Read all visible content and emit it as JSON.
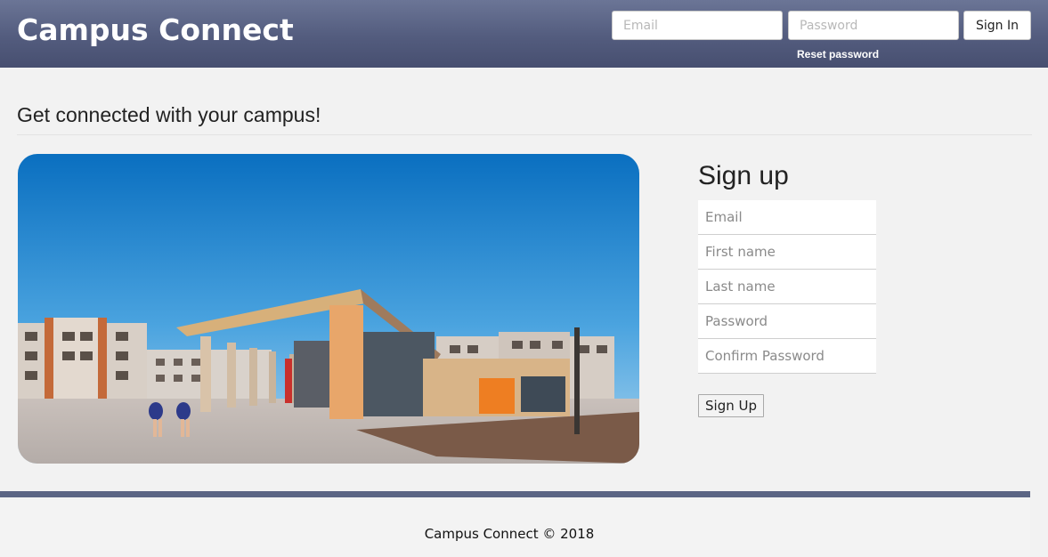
{
  "header": {
    "brand": "Campus Connect",
    "login": {
      "email_placeholder": "Email",
      "password_placeholder": "Password",
      "signin_label": "Sign In",
      "reset_label": "Reset password"
    }
  },
  "main": {
    "tagline": "Get connected with your campus!",
    "signup": {
      "title": "Sign up",
      "fields": [
        {
          "placeholder": "Email"
        },
        {
          "placeholder": "First name"
        },
        {
          "placeholder": "Last name"
        },
        {
          "placeholder": "Password"
        },
        {
          "placeholder": "Confirm Password"
        }
      ],
      "button_label": "Sign Up"
    }
  },
  "footer": {
    "text": "Campus Connect © 2018"
  },
  "colors": {
    "header": "#535c7e",
    "footer_bar": "#5b6584",
    "background": "#f2f2f2"
  }
}
